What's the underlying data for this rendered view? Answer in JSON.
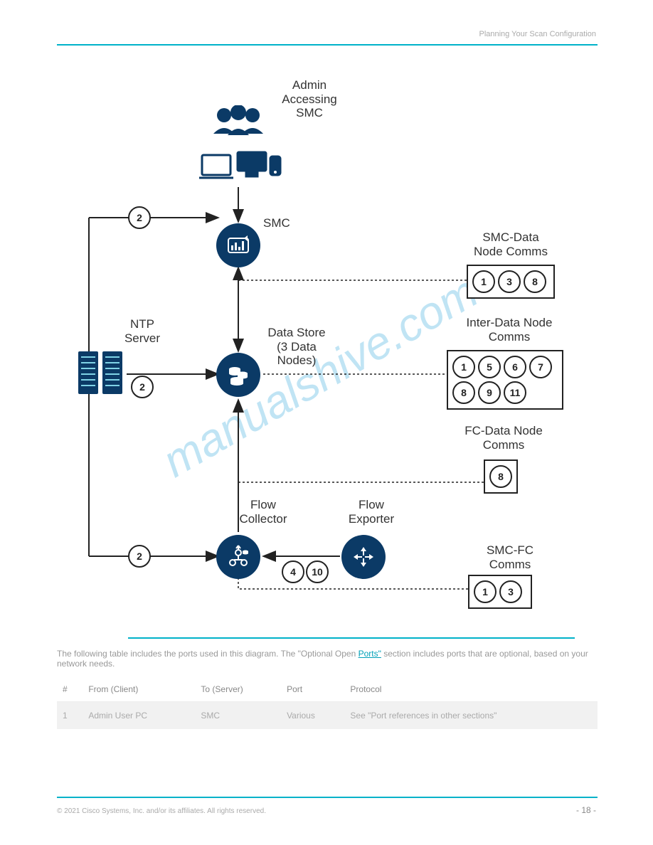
{
  "header": {
    "text": "Planning Your Scan Configuration"
  },
  "footer": {
    "left": "© 2021 Cisco Systems, Inc. and/or its affiliates. All rights reserved.",
    "right": "- 18 -"
  },
  "diagram": {
    "admin_label": "Admin\nAccessing\nSMC",
    "smc_label": "SMC",
    "ntp_label": "NTP\nServer",
    "datastore_label": "Data Store\n(3 Data\nNodes)",
    "flowcollector_label": "Flow\nCollector",
    "flowexporter_label": "Flow\nExporter",
    "edge_pills": {
      "ntp_smc": "2",
      "ntp_ds": "2",
      "ntp_fc": "2",
      "fe_fc_a": "4",
      "fe_fc_b": "10"
    },
    "comms": [
      {
        "label": "SMC-Data\nNode Comms",
        "items": [
          "1",
          "3",
          "8"
        ]
      },
      {
        "label": "Inter-Data Node\nComms",
        "items": [
          "1",
          "5",
          "6",
          "7",
          "8",
          "9",
          "11"
        ]
      },
      {
        "label": "FC-Data Node\nComms",
        "items": [
          "8"
        ]
      },
      {
        "label": "SMC-FC\nComms",
        "items": [
          "1",
          "3"
        ]
      }
    ]
  },
  "legend": {
    "intro": "The following table includes the ports used in this diagram. The \"Optional Open",
    "link": "Ports\"",
    "cont": " section includes ports that are optional, based on your network needs.",
    "table": {
      "columns": [
        "#",
        "From (Client)",
        "To (Server)",
        "Port",
        "Protocol"
      ],
      "rows": [
        {
          "n": "1",
          "from": "Admin User PC",
          "to": "SMC",
          "port": "Various",
          "proto": "See \"Port references in other sections\""
        }
      ]
    }
  }
}
